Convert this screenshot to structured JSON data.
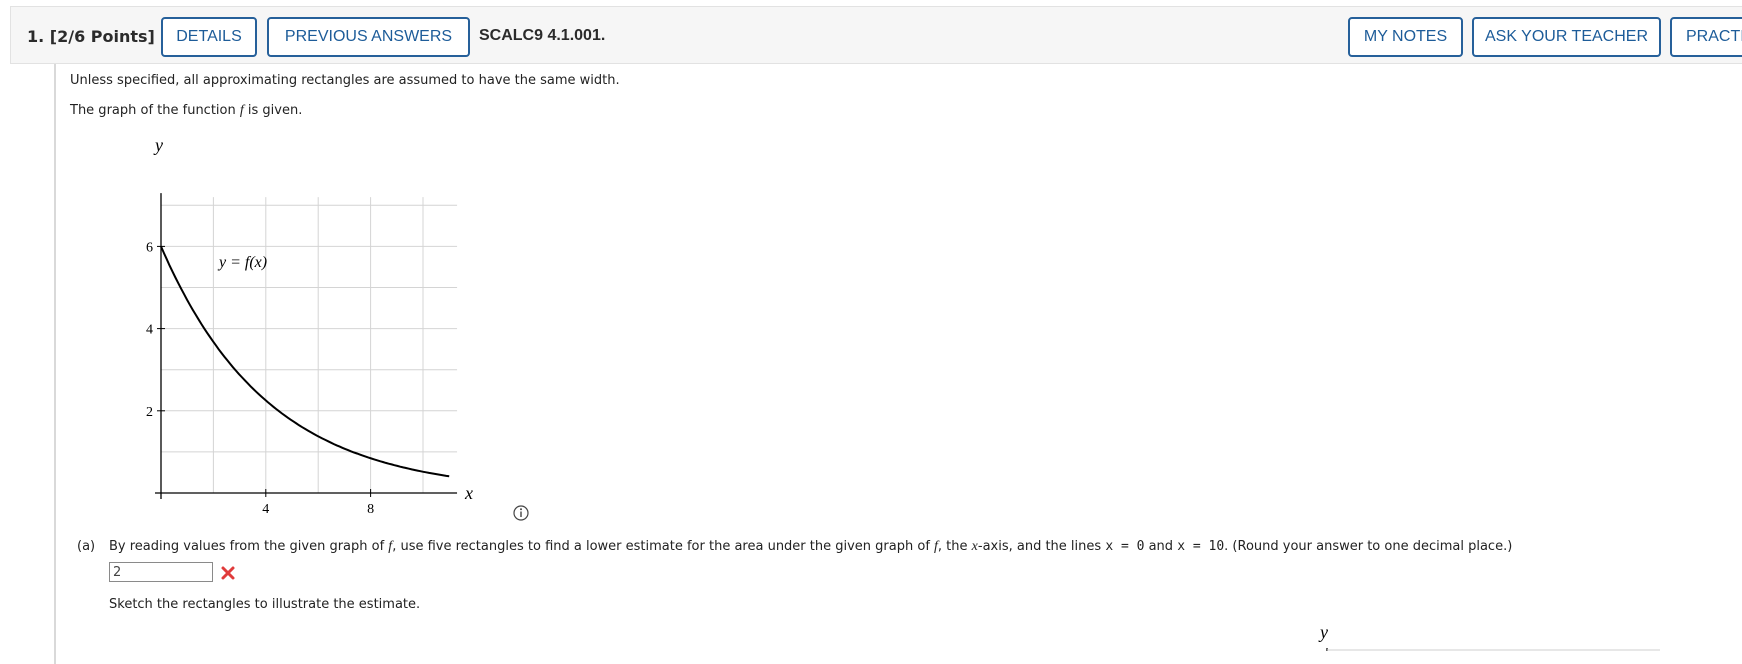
{
  "header": {
    "question_number": "1.",
    "points": "[2/6 Points]",
    "details_label": "DETAILS",
    "previous_answers_label": "PREVIOUS ANSWERS",
    "problem_code": "SCALC9 4.1.001.",
    "my_notes_label": "MY NOTES",
    "ask_teacher_label": "ASK YOUR TEACHER",
    "practice_label": "PRACTI"
  },
  "body": {
    "intro_text": "Unless specified, all approximating rectangles are assumed to have the same width.",
    "given_prefix": "The graph of the function ",
    "given_var": "f",
    "given_suffix": " is given."
  },
  "graph": {
    "y_axis_label": "y",
    "x_axis_label": "x",
    "curve_label": "y = f(x)",
    "y_ticks": [
      "2",
      "4",
      "6"
    ],
    "x_ticks": [
      "4",
      "8"
    ]
  },
  "part_a": {
    "label": "(a)",
    "q1": "By reading values from the given graph of ",
    "f1": "f",
    "q2": ", use five rectangles to find a lower estimate for the area under the given graph of ",
    "f2": "f",
    "q3": ", the ",
    "xvar": "x",
    "q4": "-axis, and the lines ",
    "eq1": "x = 0",
    "q5": " and ",
    "eq2": "x = 10",
    "q6": ". (Round your answer to one decimal place.)",
    "answer_value": "2",
    "sketch_text": "Sketch the rectangles to illustrate the estimate."
  },
  "second_graph": {
    "y_axis_label": "y"
  },
  "colors": {
    "button_border": "#26609a",
    "button_text": "#1d5c99",
    "wrong_mark": "#e03b3b"
  }
}
